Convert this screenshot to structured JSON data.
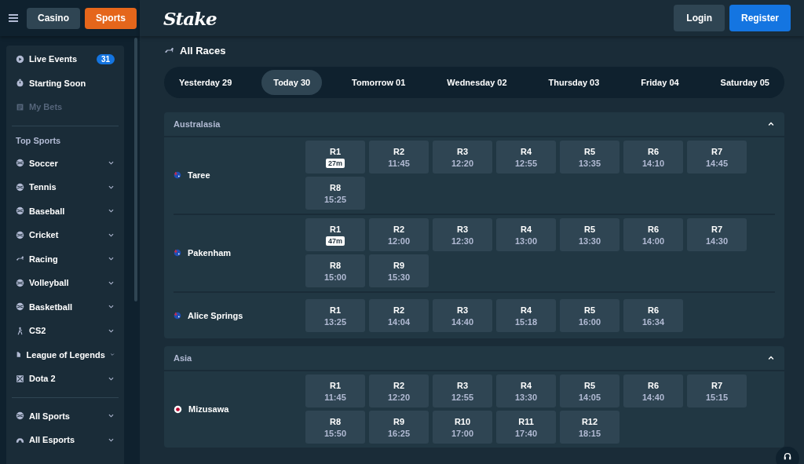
{
  "header": {
    "nav_buttons": [
      {
        "label": "Casino",
        "selected": false
      },
      {
        "label": "Sports",
        "selected": true
      }
    ],
    "logo": "Stake",
    "login": "Login",
    "register": "Register"
  },
  "sidebar": {
    "top_items": [
      {
        "label": "Live Events",
        "badge": "31",
        "disabled": false
      },
      {
        "label": "Starting Soon",
        "disabled": false
      },
      {
        "label": "My Bets",
        "disabled": true
      }
    ],
    "section_title": "Top Sports",
    "sports": [
      {
        "label": "Soccer"
      },
      {
        "label": "Tennis"
      },
      {
        "label": "Baseball"
      },
      {
        "label": "Cricket"
      },
      {
        "label": "Racing"
      },
      {
        "label": "Volleyball"
      },
      {
        "label": "Basketball"
      },
      {
        "label": "CS2"
      },
      {
        "label": "League of Legends"
      },
      {
        "label": "Dota 2"
      }
    ],
    "more": [
      {
        "label": "All Sports"
      },
      {
        "label": "All Esports"
      }
    ]
  },
  "page_title": "All Races",
  "day_tabs": [
    {
      "label": "Yesterday 29",
      "selected": false
    },
    {
      "label": "Today 30",
      "selected": true
    },
    {
      "label": "Tomorrow 01",
      "selected": false
    },
    {
      "label": "Wednesday 02",
      "selected": false
    },
    {
      "label": "Thursday 03",
      "selected": false
    },
    {
      "label": "Friday 04",
      "selected": false
    },
    {
      "label": "Saturday 05",
      "selected": false
    }
  ],
  "regions": [
    {
      "name": "Australasia",
      "expanded": true,
      "venues": [
        {
          "name": "Taree",
          "kind": "australia",
          "races": [
            {
              "race": "R1",
              "time": "27m",
              "kind": "countdown"
            },
            {
              "race": "R2",
              "time": "11:45",
              "kind": "time"
            },
            {
              "race": "R3",
              "time": "12:20",
              "kind": "time"
            },
            {
              "race": "R4",
              "time": "12:55",
              "kind": "time"
            },
            {
              "race": "R5",
              "time": "13:35",
              "kind": "time"
            },
            {
              "race": "R6",
              "time": "14:10",
              "kind": "time"
            },
            {
              "race": "R7",
              "time": "14:45",
              "kind": "time"
            },
            {
              "race": "R8",
              "time": "15:25",
              "kind": "time"
            }
          ]
        },
        {
          "name": "Pakenham",
          "kind": "australia",
          "races": [
            {
              "race": "R1",
              "time": "47m",
              "kind": "countdown"
            },
            {
              "race": "R2",
              "time": "12:00",
              "kind": "time"
            },
            {
              "race": "R3",
              "time": "12:30",
              "kind": "time"
            },
            {
              "race": "R4",
              "time": "13:00",
              "kind": "time"
            },
            {
              "race": "R5",
              "time": "13:30",
              "kind": "time"
            },
            {
              "race": "R6",
              "time": "14:00",
              "kind": "time"
            },
            {
              "race": "R7",
              "time": "14:30",
              "kind": "time"
            },
            {
              "race": "R8",
              "time": "15:00",
              "kind": "time"
            },
            {
              "race": "R9",
              "time": "15:30",
              "kind": "time"
            }
          ]
        },
        {
          "name": "Alice Springs",
          "kind": "australia",
          "races": [
            {
              "race": "R1",
              "time": "13:25",
              "kind": "time"
            },
            {
              "race": "R2",
              "time": "14:04",
              "kind": "time"
            },
            {
              "race": "R3",
              "time": "14:40",
              "kind": "time"
            },
            {
              "race": "R4",
              "time": "15:18",
              "kind": "time"
            },
            {
              "race": "R5",
              "time": "16:00",
              "kind": "time"
            },
            {
              "race": "R6",
              "time": "16:34",
              "kind": "time"
            }
          ]
        }
      ]
    },
    {
      "name": "Asia",
      "expanded": true,
      "venues": [
        {
          "name": "Mizusawa",
          "kind": "japan",
          "races": [
            {
              "race": "R1",
              "time": "11:45",
              "kind": "time"
            },
            {
              "race": "R2",
              "time": "12:20",
              "kind": "time"
            },
            {
              "race": "R3",
              "time": "12:55",
              "kind": "time"
            },
            {
              "race": "R4",
              "time": "13:30",
              "kind": "time"
            },
            {
              "race": "R5",
              "time": "14:05",
              "kind": "time"
            },
            {
              "race": "R6",
              "time": "14:40",
              "kind": "time"
            },
            {
              "race": "R7",
              "time": "15:15",
              "kind": "time"
            },
            {
              "race": "R8",
              "time": "15:50",
              "kind": "time"
            },
            {
              "race": "R9",
              "time": "16:25",
              "kind": "time"
            },
            {
              "race": "R10",
              "time": "17:00",
              "kind": "time"
            },
            {
              "race": "R11",
              "time": "17:40",
              "kind": "time"
            },
            {
              "race": "R12",
              "time": "18:15",
              "kind": "time"
            }
          ]
        }
      ]
    }
  ]
}
